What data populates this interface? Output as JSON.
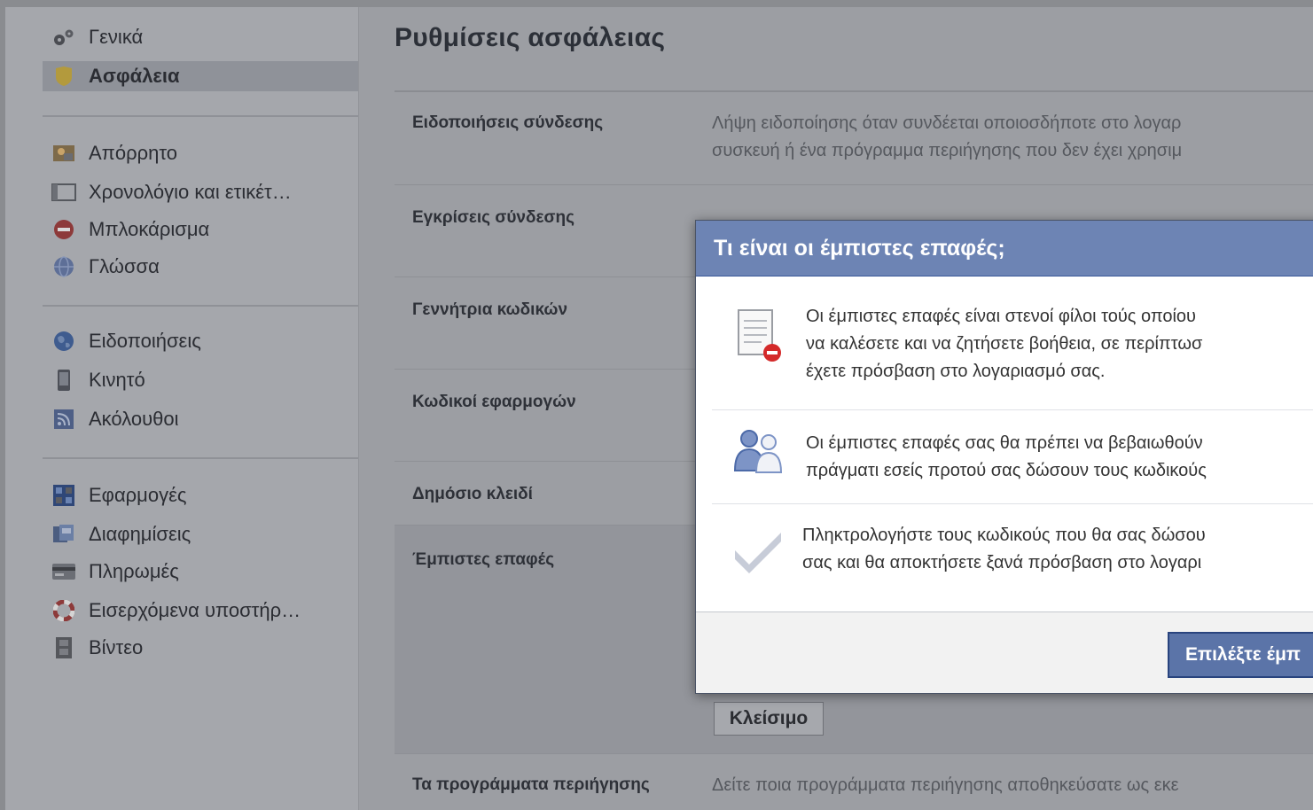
{
  "sidebar": {
    "items": [
      {
        "label": "Γενικά",
        "icon": "gears-icon"
      },
      {
        "label": "Ασφάλεια",
        "icon": "shield-icon"
      },
      {
        "label": "Απόρρητο",
        "icon": "privacy-icon"
      },
      {
        "label": "Χρονολόγιο και ετικέτ…",
        "icon": "timeline-icon"
      },
      {
        "label": "Μπλοκάρισμα",
        "icon": "block-icon"
      },
      {
        "label": "Γλώσσα",
        "icon": "globe-icon"
      },
      {
        "label": "Ειδοποιήσεις",
        "icon": "world-icon"
      },
      {
        "label": "Κινητό",
        "icon": "mobile-icon"
      },
      {
        "label": "Ακόλουθοι",
        "icon": "rss-icon"
      },
      {
        "label": "Εφαρμογές",
        "icon": "apps-icon"
      },
      {
        "label": "Διαφημίσεις",
        "icon": "ads-icon"
      },
      {
        "label": "Πληρωμές",
        "icon": "card-icon"
      },
      {
        "label": "Εισερχόμενα υποστήρ…",
        "icon": "lifebuoy-icon"
      },
      {
        "label": "Βίντεο",
        "icon": "film-icon"
      }
    ]
  },
  "main": {
    "title": "Ρυθμίσεις ασφάλειας",
    "rows": [
      {
        "label": "Ειδοποιήσεις σύνδεσης",
        "desc_line1": "Λήψη ειδοποίησης όταν συνδέεται οποιοσδήποτε στο λογαρ",
        "desc_line2": "συσκευή ή ένα πρόγραμμα περιήγησης που δεν έχει χρησιμ"
      },
      {
        "label": "Εγκρίσεις σύνδεσης"
      },
      {
        "label": "Γεννήτρια κωδικών"
      },
      {
        "label": "Κωδικοί εφαρμογών"
      },
      {
        "label": "Δημόσιο κλειδί"
      },
      {
        "label": "Έμπιστες επαφές"
      },
      {
        "label": "Τα προγράμματα περιήγησης",
        "desc_line1": "Δείτε ποια προγράμματα περιήγησης αποθηκεύσατε ως εκε"
      }
    ],
    "close_label": "Κλείσιμο"
  },
  "modal": {
    "title": "Τι είναι οι έμπιστες επαφές;",
    "items": [
      {
        "icon": "document-icon",
        "lines": [
          "Οι έμπιστες επαφές είναι στενοί φίλοι τούς οποίου",
          "να καλέσετε και να ζητήσετε βοήθεια, σε περίπτωσ",
          "έχετε πρόσβαση στο λογαριασμό σας."
        ]
      },
      {
        "icon": "friends-icon",
        "lines": [
          "Οι έμπιστες επαφές σας θα πρέπει να βεβαιωθούν",
          "πράγματι εσείς προτού σας δώσουν τους κωδικούς"
        ]
      },
      {
        "icon": "checkmark-icon",
        "lines": [
          "Πληκτρολογήστε τους κωδικούς που θα σας δώσου",
          "σας και θα αποκτήσετε ξανά πρόσβαση στο λογαρι"
        ]
      }
    ],
    "primary_button": "Επιλέξτε έμπ"
  },
  "colors": {
    "header_blue": "#6d84b4",
    "button_blue": "#5b74a8",
    "overlay_gray": "#9c9ea3"
  }
}
